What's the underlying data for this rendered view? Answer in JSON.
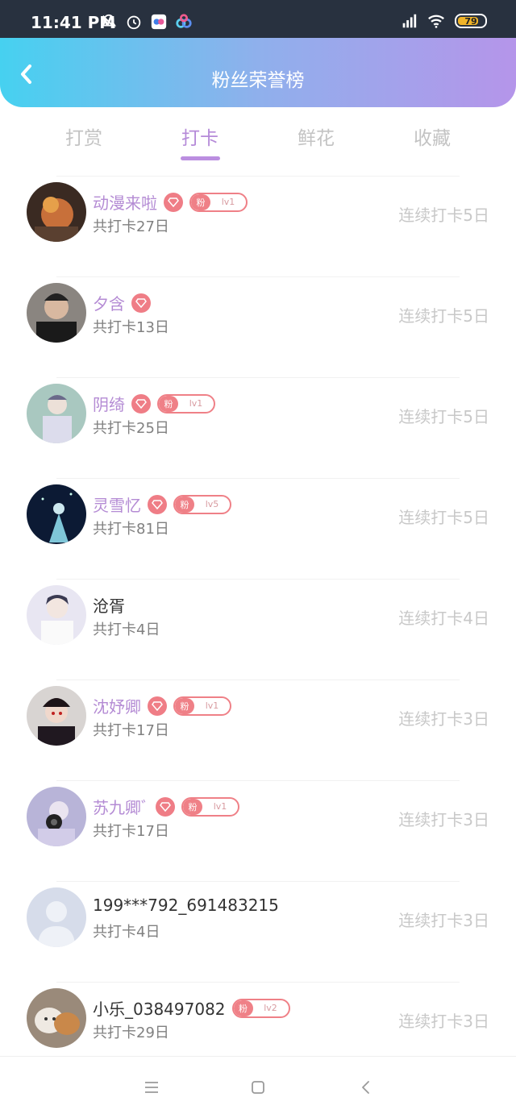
{
  "status": {
    "time": "11:41 PM",
    "battery": "79",
    "left_icons": [
      "bell-off-icon",
      "alarm-icon",
      "app-icon",
      "cloud-app-icon"
    ],
    "right_icons": [
      "signal-icon",
      "wifi-icon",
      "battery-icon"
    ]
  },
  "header": {
    "title": "粉丝荣誉榜",
    "back_icon": "chevron-left-icon"
  },
  "tabs": [
    {
      "label": "打赏",
      "active": false
    },
    {
      "label": "打卡",
      "active": true
    },
    {
      "label": "鲜花",
      "active": false
    },
    {
      "label": "收藏",
      "active": false
    }
  ],
  "rows": [
    {
      "name": "动漫来啦",
      "vip": true,
      "fan_label": "粉",
      "fan_level": "lv1",
      "total": "共打卡27日",
      "streak": "连续打卡5日"
    },
    {
      "name": "夕含",
      "vip": true,
      "fan_label": "",
      "fan_level": "",
      "total": "共打卡13日",
      "streak": "连续打卡5日"
    },
    {
      "name": "阴绮",
      "vip": true,
      "fan_label": "粉",
      "fan_level": "lv1",
      "total": "共打卡25日",
      "streak": "连续打卡5日"
    },
    {
      "name": "灵雪忆",
      "vip": true,
      "fan_label": "粉",
      "fan_level": "lv5",
      "total": "共打卡81日",
      "streak": "连续打卡5日"
    },
    {
      "name": "沧胥",
      "vip": false,
      "fan_label": "",
      "fan_level": "",
      "total": "共打卡4日",
      "streak": "连续打卡4日"
    },
    {
      "name": "沈妤卿",
      "vip": true,
      "fan_label": "粉",
      "fan_level": "lv1",
      "total": "共打卡17日",
      "streak": "连续打卡3日"
    },
    {
      "name": "苏九卿ﾞ",
      "vip": true,
      "fan_label": "粉",
      "fan_level": "lv1",
      "total": "共打卡17日",
      "streak": "连续打卡3日"
    },
    {
      "name": "199***792_691483215",
      "vip": false,
      "fan_label": "",
      "fan_level": "",
      "total": "共打卡4日",
      "streak": "连续打卡3日"
    },
    {
      "name": "小乐_038497082",
      "vip": false,
      "fan_label": "粉",
      "fan_level": "lv2",
      "total": "共打卡29日",
      "streak": "连续打卡3日"
    }
  ],
  "colors": {
    "header_start": "#46d1f0",
    "header_end": "#b595ea",
    "accent": "#b58ad8",
    "badge": "#ef7d86"
  },
  "bottom_nav": [
    "menu-icon",
    "home-icon",
    "back-icon"
  ]
}
